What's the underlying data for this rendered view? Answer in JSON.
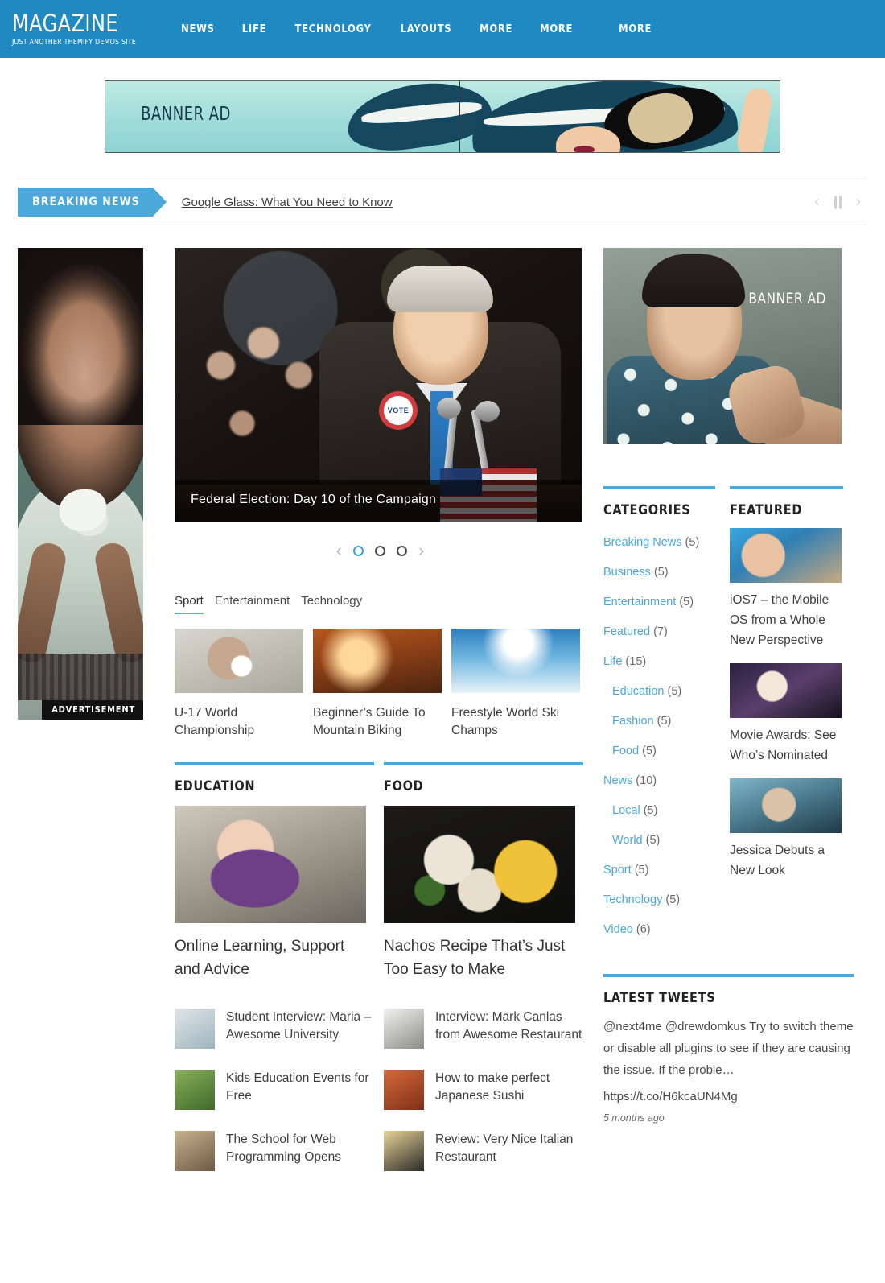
{
  "header": {
    "logo_title": "MAGAZINE",
    "logo_tagline": "JUST ANOTHER THEMIFY DEMOS SITE",
    "nav": [
      {
        "label": "NEWS"
      },
      {
        "label": "LIFE"
      },
      {
        "label": "TECHNOLOGY"
      },
      {
        "label": "LAYOUTS"
      },
      {
        "label": "MORE"
      },
      {
        "label": "MORE"
      },
      {
        "label": "MORE"
      }
    ],
    "brand_color": "#2189c1"
  },
  "top_ad": {
    "label": "BANNER AD"
  },
  "breaking": {
    "tag": "BREAKING NEWS",
    "headline": "Google Glass: What You Need to Know",
    "prev_icon": "chevron-left-icon",
    "pause_icon": "pause-icon",
    "next_icon": "chevron-right-icon"
  },
  "left_ad": {
    "label": "ADVERTISEMENT"
  },
  "slider": {
    "caption": "Federal Election: Day 10 of the Campaign",
    "badge_text": "VOTE",
    "dots": [
      {
        "active": true
      },
      {
        "active": false
      },
      {
        "active": false
      }
    ]
  },
  "tabs": {
    "items": [
      {
        "label": "Sport",
        "active": true
      },
      {
        "label": "Entertainment",
        "active": false
      },
      {
        "label": "Technology",
        "active": false
      }
    ],
    "cards": [
      {
        "title": "U-17 World Championship"
      },
      {
        "title": "Beginner’s Guide To Mountain Biking"
      },
      {
        "title": "Freestyle World Ski Champs"
      }
    ]
  },
  "sections": [
    {
      "title": "EDUCATION",
      "hero_title": "Online Learning, Support and Advice",
      "items": [
        {
          "title": "Student Interview: Maria – Awesome University"
        },
        {
          "title": "Kids Education Events for Free"
        },
        {
          "title": "The School for Web Programming Opens"
        }
      ]
    },
    {
      "title": "FOOD",
      "hero_title": "Nachos Recipe That’s Just Too Easy to Make",
      "items": [
        {
          "title": "Interview: Mark Canlas from Awesome Restaurant"
        },
        {
          "title": "How to make perfect Japanese Sushi"
        },
        {
          "title": "Review: Very Nice Italian Restaurant"
        }
      ]
    }
  ],
  "sidebar": {
    "ad": {
      "label": "BANNER AD"
    },
    "categories": {
      "title": "CATEGORIES",
      "items": [
        {
          "label": "Breaking News",
          "count": "(5)",
          "child": false
        },
        {
          "label": "Business",
          "count": "(5)",
          "child": false
        },
        {
          "label": "Entertainment",
          "count": "(5)",
          "child": false
        },
        {
          "label": "Featured",
          "count": "(7)",
          "child": false
        },
        {
          "label": "Life",
          "count": "(15)",
          "child": false
        },
        {
          "label": "Education",
          "count": "(5)",
          "child": true
        },
        {
          "label": "Fashion",
          "count": "(5)",
          "child": true
        },
        {
          "label": "Food",
          "count": "(5)",
          "child": true
        },
        {
          "label": "News",
          "count": "(10)",
          "child": false
        },
        {
          "label": "Local",
          "count": "(5)",
          "child": true
        },
        {
          "label": "World",
          "count": "(5)",
          "child": true
        },
        {
          "label": "Sport",
          "count": "(5)",
          "child": false
        },
        {
          "label": "Technology",
          "count": "(5)",
          "child": false
        },
        {
          "label": "Video",
          "count": "(6)",
          "child": false
        }
      ]
    },
    "featured": {
      "title": "FEATURED",
      "items": [
        {
          "title": "iOS7 – the Mobile OS from a Whole New Perspective"
        },
        {
          "title": "Movie Awards: See Who’s Nominated"
        },
        {
          "title": "Jessica Debuts a New Look"
        }
      ]
    },
    "tweets": {
      "title": "LATEST TWEETS",
      "text": "@next4me @drewdomkus Try to switch theme or disable all plugins to see if they are causing the issue. If the proble…",
      "link": "https://t.co/H6kcaUN4Mg",
      "time": "5 months ago"
    }
  }
}
